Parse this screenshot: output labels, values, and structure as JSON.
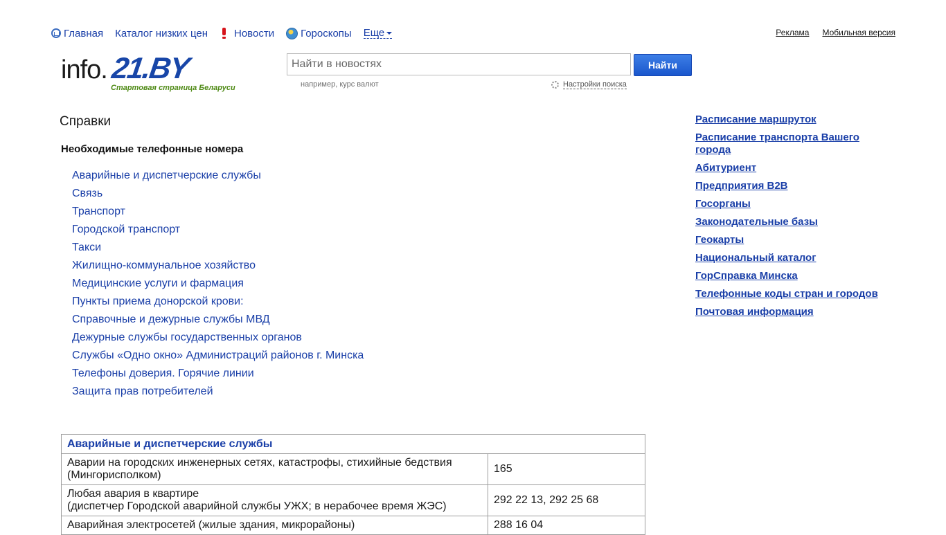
{
  "topnav": {
    "home": "Главная",
    "catalog": "Каталог низких цен",
    "news": "Новости",
    "horoscopes": "Гороскопы",
    "more": "Еще"
  },
  "toplinks": {
    "ads": "Реклама",
    "mobile": "Мобильная версия"
  },
  "logo": {
    "prefix": "info.",
    "brand": "21.BY",
    "tagline": "Стартовая страница Беларуси"
  },
  "search": {
    "placeholder": "Найти в новостях",
    "button": "Найти",
    "hint": "например, курс валют",
    "settings": "Настройки поиска"
  },
  "page": {
    "title": "Справки",
    "section_title": "Необходимые телефонные номера",
    "anchors": [
      "Аварийные и диспетчерские службы",
      "Связь",
      "Транспорт",
      "Городской транспорт",
      "Такси",
      "Жилищно-коммунальное хозяйство",
      "Медицинские услуги и фармация",
      "Пункты приема донорской крови:",
      "Справочные и дежурные службы МВД",
      "Дежурные службы государственных органов",
      "Службы «Одно окно» Администраций районов г. Минска",
      "Телефоны доверия. Горячие линии",
      "Защита прав потребителей"
    ]
  },
  "sidebar": {
    "links": [
      "Расписание маршруток",
      "Расписание транспорта Вашего города",
      "Абитуриент",
      "Предприятия B2B",
      "Госорганы",
      "Законодательные базы",
      "Геокарты",
      "Национальный каталог",
      "ГорСправка Минска",
      "Телефонные коды стран и городов",
      "Почтовая информация"
    ]
  },
  "table": {
    "header": "Аварийные и диспетчерские службы",
    "rows": [
      {
        "name_line1": "Аварии на городских инженерных сетях, катастрофы, стихийные бедствия",
        "name_line2": "(Мингорисполком)",
        "phone": "165"
      },
      {
        "name_line1": "Любая авария в квартире",
        "name_line2": "(диспетчер Городской аварийной службы УЖХ; в нерабочее время ЖЭС)",
        "phone": "292 22 13, 292 25 68"
      },
      {
        "name_line1": "Аварийная электросетей (жилые здания, микрорайоны)",
        "name_line2": "",
        "phone": "288 16 04"
      }
    ]
  }
}
